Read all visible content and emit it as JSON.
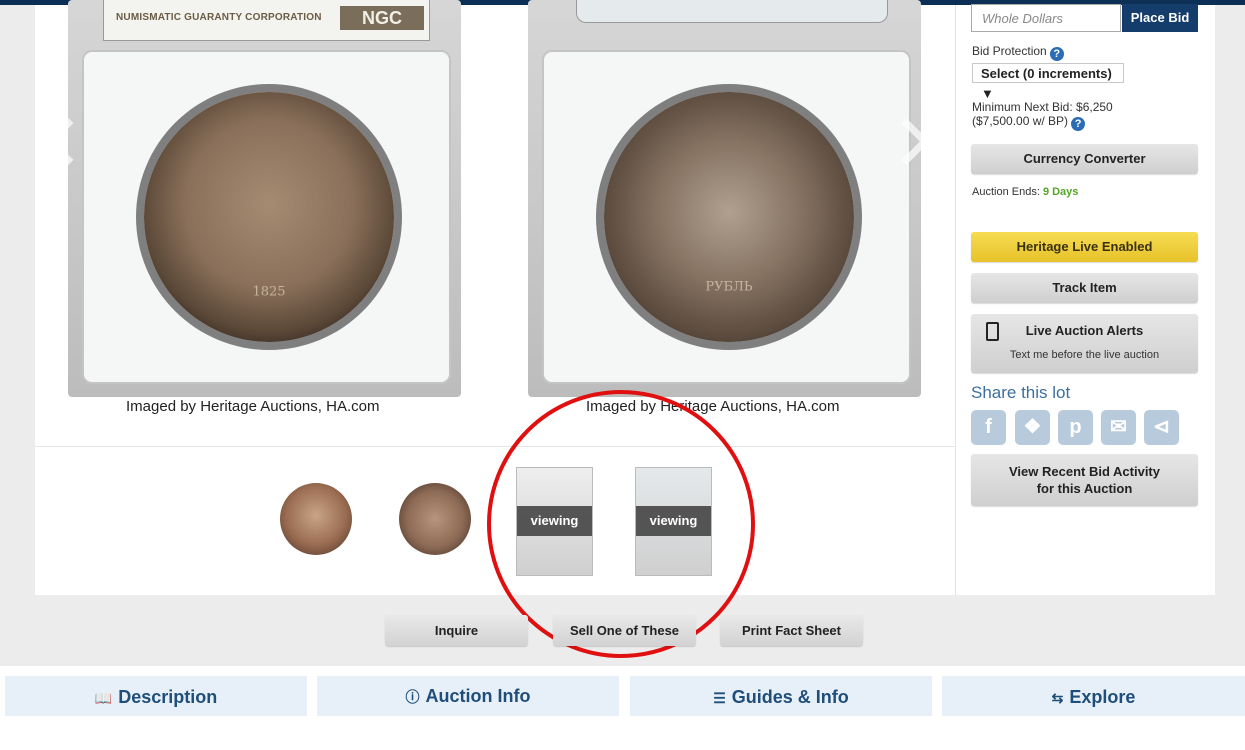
{
  "gallery": {
    "slab_label_left": "NUMISMATIC GUARANTY CORPORATION",
    "ngc_logo": "NGC",
    "coin_left_date": "1825",
    "coin_right_text": "РУБЛЬ",
    "caption_left": "Imaged by Heritage Auctions, HA.com",
    "caption_right": "Imaged by Heritage Auctions, HA.com",
    "thumbnails": [
      {
        "overlay": ""
      },
      {
        "overlay": ""
      },
      {
        "overlay": "viewing"
      },
      {
        "overlay": "viewing"
      }
    ]
  },
  "actions": {
    "inquire": "Inquire",
    "sell": "Sell One of These",
    "print": "Print Fact Sheet"
  },
  "tabs": [
    {
      "label": "Description",
      "icon": "book-icon"
    },
    {
      "label": "Auction Info",
      "icon": "info-icon"
    },
    {
      "label": "Guides & Info",
      "icon": "list-icon"
    },
    {
      "label": "Explore",
      "icon": "exchange-icon"
    }
  ],
  "sidebar": {
    "bid_placeholder": "Whole Dollars",
    "place_bid": "Place Bid",
    "bid_protection_label": "Bid Protection",
    "bid_protection_value": "Select (0 increments)",
    "min_next_bid_line1": "Minimum Next Bid: $6,250",
    "min_next_bid_line2": "($7,500.00 w/ BP)",
    "currency_converter": "Currency Converter",
    "auction_ends_label": "Auction Ends:",
    "auction_ends_value": "9 Days",
    "heritage_live": "Heritage Live Enabled",
    "track_item": "Track Item",
    "live_alerts_title": "Live Auction Alerts",
    "live_alerts_sub": "Text me before the live auction",
    "share_label": "Share this lot",
    "social": [
      "facebook-icon",
      "twitter-icon",
      "pinterest-icon",
      "email-icon",
      "share-icon"
    ],
    "recent_bids_line1": "View Recent Bid Activity",
    "recent_bids_line2": "for this Auction"
  },
  "colors": {
    "annotation_circle": "#e01010",
    "place_bid_bg": "#143d6b",
    "heritage_live_bg": "#f0d03a",
    "tab_text": "#1f4e7a",
    "auction_ends_green": "#55a42a"
  }
}
